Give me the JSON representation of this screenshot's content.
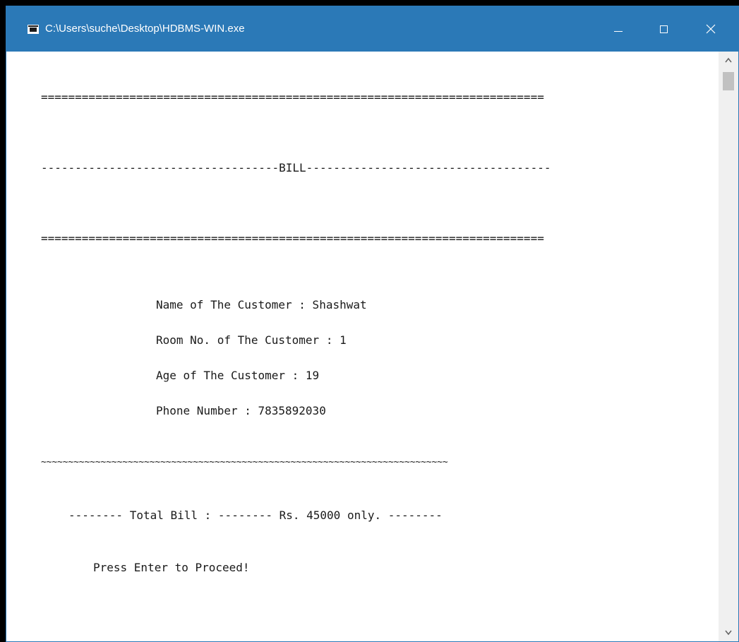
{
  "window": {
    "title": "C:\\Users\\suche\\Desktop\\HDBMS-WIN.exe",
    "titlebar_color": "#2b79b7",
    "caption_buttons": [
      "minimize-icon",
      "maximize-icon",
      "close-icon"
    ]
  },
  "console": {
    "separator_top": "==========================================================================",
    "bill_heading": "-----------------------------------BILL------------------------------------",
    "separator_bottom": "==========================================================================",
    "customer": {
      "name_line": "Name of The Customer : Shashwat",
      "room_line": "Room No. of The Customer : 1",
      "age_line": "Age of The Customer : 19",
      "phone_line": "Phone Number : 7835892030"
    },
    "tilde_rule": "~~~~~~~~~~~~~~~~~~~~~~~~~~~~~~~~~~~~~~~~~~~~~~~~~~~~~~~~~~~~~~~~~~~~~~~~~~~",
    "total_line": "-------- Total Bill : -------- Rs. 45000 only. --------",
    "prompt_line": "Press Enter to Proceed!"
  },
  "scrollbar": {
    "up_icon": "chevron-up-icon",
    "down_icon": "chevron-down-icon",
    "position_fraction": 0.0
  }
}
